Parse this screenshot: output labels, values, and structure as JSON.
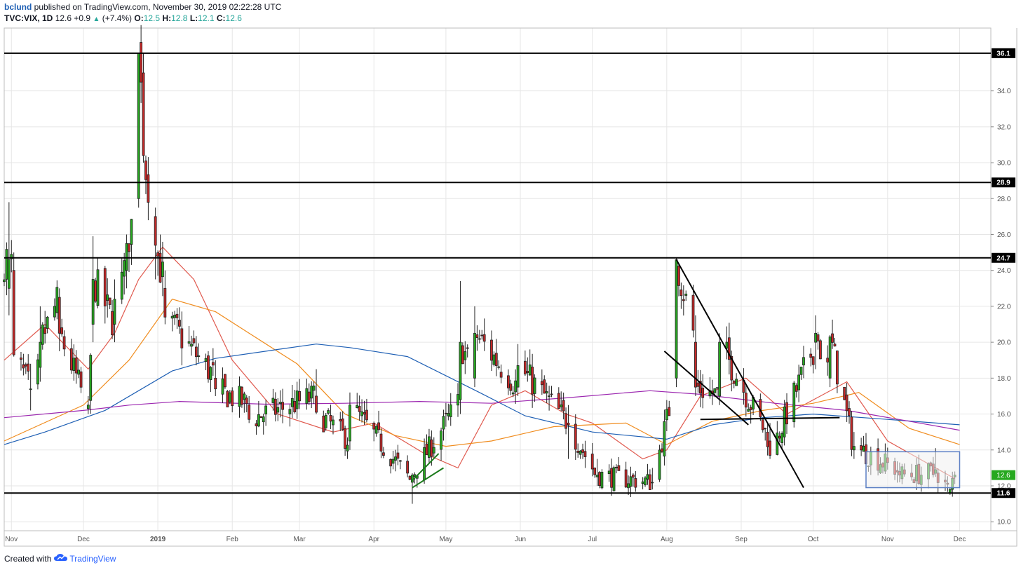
{
  "header": {
    "user": "bclund",
    "published": "published on TradingView.com, November 30, 2019 02:22:28 UTC",
    "symbol": "TVC:VIX, 1D",
    "last": "12.6",
    "change": "+0.9",
    "change_pct": "(+7.4%)",
    "o_label": "O:",
    "o": "12.5",
    "h_label": "H:",
    "h": "12.8",
    "l_label": "L:",
    "l": "12.1",
    "c_label": "C:",
    "c": "12.6"
  },
  "footer": {
    "created_with": "Created with",
    "brand": "TradingView"
  },
  "colors": {
    "up": "#26a81f",
    "down": "#c62828",
    "grid": "#e6e6e6",
    "sma20": "#e05a4f",
    "sma50": "#f08c1e",
    "sma100": "#1e5fb4",
    "sma200": "#9c27b0",
    "box_border": "#5b7fc4",
    "box_fill": "#f0f0f0"
  },
  "chart_data": {
    "type": "candlestick",
    "symbol": "TVC:VIX",
    "interval": "1D",
    "ylim": [
      9.5,
      37.5
    ],
    "y_ticks": [
      10.0,
      12.0,
      14.0,
      16.0,
      18.0,
      20.0,
      22.0,
      24.0,
      26.0,
      28.0,
      30.0,
      32.0,
      34.0
    ],
    "x_ticks": [
      "Nov",
      "Dec",
      "2019",
      "Feb",
      "Mar",
      "Apr",
      "May",
      "Jun",
      "Jul",
      "Aug",
      "Sep",
      "Oct",
      "Nov",
      "Dec"
    ],
    "x_start": "2018-10-29",
    "x_end": "2019-12-14",
    "grid": true,
    "horizontal_levels": [
      36.1,
      28.9,
      24.7,
      11.6
    ],
    "level_labels": [
      "36.1",
      "28.9",
      "24.7",
      "11.6"
    ],
    "last_price_label": "12.6",
    "ohlc_sample": [
      {
        "date": "2018-10-31",
        "o": 23.0,
        "h": 27.8,
        "l": 21.5,
        "c": 24.6
      },
      {
        "date": "2018-11-02",
        "o": 24.0,
        "h": 25.0,
        "l": 19.2,
        "c": 19.3
      },
      {
        "date": "2018-11-09",
        "o": 17.4,
        "h": 18.8,
        "l": 16.2,
        "c": 17.4
      },
      {
        "date": "2018-11-13",
        "o": 18.6,
        "h": 22.0,
        "l": 17.8,
        "c": 20.0
      },
      {
        "date": "2018-11-21",
        "o": 22.5,
        "h": 23.0,
        "l": 19.5,
        "c": 20.5
      },
      {
        "date": "2018-12-03",
        "o": 16.3,
        "h": 17.0,
        "l": 16.0,
        "c": 16.5
      },
      {
        "date": "2018-12-05",
        "o": 21.0,
        "h": 25.9,
        "l": 20.0,
        "c": 23.5
      },
      {
        "date": "2018-12-14",
        "o": 21.0,
        "h": 23.5,
        "l": 20.0,
        "c": 22.4
      },
      {
        "date": "2018-12-19",
        "o": 24.0,
        "h": 26.0,
        "l": 23.0,
        "c": 25.5
      },
      {
        "date": "2018-12-24",
        "o": 28.0,
        "h": 36.1,
        "l": 27.5,
        "c": 36.1
      },
      {
        "date": "2018-12-26",
        "o": 35.0,
        "h": 36.1,
        "l": 30.0,
        "c": 30.4
      },
      {
        "date": "2018-12-31",
        "o": 27.0,
        "h": 27.5,
        "l": 23.5,
        "c": 25.4
      },
      {
        "date": "2019-01-04",
        "o": 23.0,
        "h": 24.0,
        "l": 21.0,
        "c": 21.4
      },
      {
        "date": "2019-01-25",
        "o": 18.0,
        "h": 19.0,
        "l": 17.0,
        "c": 17.4
      },
      {
        "date": "2019-02-08",
        "o": 16.5,
        "h": 17.0,
        "l": 15.5,
        "c": 15.7
      },
      {
        "date": "2019-03-08",
        "o": 17.0,
        "h": 18.5,
        "l": 16.0,
        "c": 16.1
      },
      {
        "date": "2019-03-22",
        "o": 14.5,
        "h": 17.2,
        "l": 14.0,
        "c": 16.5
      },
      {
        "date": "2019-04-17",
        "o": 12.2,
        "h": 12.7,
        "l": 11.0,
        "c": 12.6
      },
      {
        "date": "2019-05-07",
        "o": 16.8,
        "h": 23.4,
        "l": 16.0,
        "c": 20.0
      },
      {
        "date": "2019-05-13",
        "o": 18.0,
        "h": 22.0,
        "l": 17.5,
        "c": 20.5
      },
      {
        "date": "2019-05-31",
        "o": 17.5,
        "h": 19.9,
        "l": 17.0,
        "c": 18.7
      },
      {
        "date": "2019-06-21",
        "o": 15.5,
        "h": 16.5,
        "l": 13.5,
        "c": 15.4
      },
      {
        "date": "2019-07-03",
        "o": 12.5,
        "h": 13.5,
        "l": 12.0,
        "c": 12.6
      },
      {
        "date": "2019-07-26",
        "o": 12.2,
        "h": 13.0,
        "l": 11.8,
        "c": 12.2
      },
      {
        "date": "2019-08-05",
        "o": 18.0,
        "h": 24.7,
        "l": 17.5,
        "c": 24.6
      },
      {
        "date": "2019-08-13",
        "o": 20.0,
        "h": 21.5,
        "l": 17.0,
        "c": 17.5
      },
      {
        "date": "2019-08-23",
        "o": 17.0,
        "h": 20.5,
        "l": 16.5,
        "c": 20.0
      },
      {
        "date": "2019-09-13",
        "o": 14.5,
        "h": 15.5,
        "l": 13.5,
        "c": 13.7
      },
      {
        "date": "2019-10-02",
        "o": 20.0,
        "h": 21.5,
        "l": 18.5,
        "c": 20.5
      },
      {
        "date": "2019-10-08",
        "o": 18.0,
        "h": 20.4,
        "l": 17.5,
        "c": 20.3
      },
      {
        "date": "2019-10-18",
        "o": 14.0,
        "h": 15.0,
        "l": 13.5,
        "c": 14.2
      },
      {
        "date": "2019-11-06",
        "o": 12.8,
        "h": 13.3,
        "l": 12.2,
        "c": 12.6
      },
      {
        "date": "2019-11-21",
        "o": 12.7,
        "h": 14.1,
        "l": 12.5,
        "c": 12.9
      },
      {
        "date": "2019-11-27",
        "o": 11.6,
        "h": 11.9,
        "l": 11.5,
        "c": 11.8
      },
      {
        "date": "2019-11-29",
        "o": 12.5,
        "h": 12.8,
        "l": 12.1,
        "c": 12.6
      }
    ],
    "moving_averages": [
      {
        "name": "MA-red",
        "color": "#e05a4f",
        "points": [
          [
            "2018-10-29",
            19.0
          ],
          [
            "2018-11-15",
            21.0
          ],
          [
            "2018-12-03",
            18.5
          ],
          [
            "2018-12-14",
            20.5
          ],
          [
            "2018-12-24",
            23.5
          ],
          [
            "2019-01-03",
            25.3
          ],
          [
            "2019-01-16",
            23.5
          ],
          [
            "2019-02-01",
            19.0
          ],
          [
            "2019-02-20",
            16.0
          ],
          [
            "2019-03-15",
            15.0
          ],
          [
            "2019-04-01",
            15.5
          ],
          [
            "2019-04-22",
            13.8
          ],
          [
            "2019-05-06",
            13.0
          ],
          [
            "2019-05-20",
            16.5
          ],
          [
            "2019-06-03",
            17.3
          ],
          [
            "2019-06-20",
            16.0
          ],
          [
            "2019-07-01",
            15.5
          ],
          [
            "2019-07-22",
            13.5
          ],
          [
            "2019-08-01",
            14.0
          ],
          [
            "2019-08-15",
            17.0
          ],
          [
            "2019-09-03",
            18.0
          ],
          [
            "2019-09-20",
            16.0
          ],
          [
            "2019-10-04",
            17.0
          ],
          [
            "2019-10-15",
            17.8
          ],
          [
            "2019-11-01",
            14.5
          ],
          [
            "2019-11-29",
            12.4
          ]
        ]
      },
      {
        "name": "MA-orange",
        "color": "#f08c1e",
        "points": [
          [
            "2018-10-29",
            14.5
          ],
          [
            "2018-12-01",
            16.5
          ],
          [
            "2018-12-20",
            19.0
          ],
          [
            "2019-01-07",
            22.4
          ],
          [
            "2019-01-25",
            21.7
          ],
          [
            "2019-02-08",
            20.5
          ],
          [
            "2019-02-28",
            18.8
          ],
          [
            "2019-03-20",
            16.0
          ],
          [
            "2019-04-10",
            14.8
          ],
          [
            "2019-05-01",
            14.2
          ],
          [
            "2019-05-20",
            14.5
          ],
          [
            "2019-06-15",
            15.3
          ],
          [
            "2019-07-15",
            15.5
          ],
          [
            "2019-08-01",
            14.3
          ],
          [
            "2019-08-20",
            15.6
          ],
          [
            "2019-09-10",
            16.2
          ],
          [
            "2019-10-01",
            16.6
          ],
          [
            "2019-10-20",
            17.2
          ],
          [
            "2019-11-10",
            15.2
          ],
          [
            "2019-12-01",
            14.3
          ]
        ]
      },
      {
        "name": "MA-blue",
        "color": "#1e5fb4",
        "points": [
          [
            "2018-10-29",
            14.3
          ],
          [
            "2018-11-15",
            15.0
          ],
          [
            "2018-12-10",
            16.2
          ],
          [
            "2019-01-07",
            18.4
          ],
          [
            "2019-01-25",
            19.1
          ],
          [
            "2019-02-20",
            19.6
          ],
          [
            "2019-03-08",
            19.9
          ],
          [
            "2019-03-22",
            19.7
          ],
          [
            "2019-04-15",
            19.2
          ],
          [
            "2019-05-15",
            17.2
          ],
          [
            "2019-06-03",
            15.9
          ],
          [
            "2019-07-01",
            15.0
          ],
          [
            "2019-08-01",
            14.6
          ],
          [
            "2019-08-20",
            15.4
          ],
          [
            "2019-09-10",
            15.8
          ],
          [
            "2019-10-01",
            16.0
          ],
          [
            "2019-11-01",
            15.7
          ],
          [
            "2019-12-01",
            15.4
          ]
        ]
      },
      {
        "name": "MA-purple",
        "color": "#9c27b0",
        "points": [
          [
            "2018-10-29",
            15.8
          ],
          [
            "2018-12-01",
            16.2
          ],
          [
            "2018-12-20",
            16.5
          ],
          [
            "2019-01-10",
            16.7
          ],
          [
            "2019-02-15",
            16.55
          ],
          [
            "2019-03-20",
            16.6
          ],
          [
            "2019-04-20",
            16.7
          ],
          [
            "2019-05-20",
            16.6
          ],
          [
            "2019-06-20",
            16.9
          ],
          [
            "2019-07-25",
            17.3
          ],
          [
            "2019-08-15",
            17.1
          ],
          [
            "2019-09-15",
            16.6
          ],
          [
            "2019-10-15",
            16.2
          ],
          [
            "2019-11-10",
            15.6
          ],
          [
            "2019-12-01",
            15.1
          ]
        ]
      }
    ],
    "drawings": [
      {
        "kind": "trendline",
        "from": [
          "2019-08-05",
          24.6
        ],
        "to": [
          "2019-09-27",
          11.9
        ]
      },
      {
        "kind": "trendline",
        "from": [
          "2019-07-31",
          19.5
        ],
        "to": [
          "2019-09-04",
          15.4
        ]
      },
      {
        "kind": "trendline",
        "from": [
          "2019-08-15",
          15.7
        ],
        "to": [
          "2019-10-12",
          15.8
        ]
      },
      {
        "kind": "trendline",
        "from": [
          "2019-04-17",
          11.9
        ],
        "to": [
          "2019-04-30",
          13.0
        ]
      },
      {
        "kind": "trendline",
        "from": [
          "2019-04-17",
          12.3
        ],
        "to": [
          "2019-04-28",
          13.8
        ]
      },
      {
        "kind": "rectangle",
        "from": [
          "2019-10-23",
          13.9
        ],
        "to": [
          "2019-12-01",
          11.9
        ]
      }
    ]
  }
}
